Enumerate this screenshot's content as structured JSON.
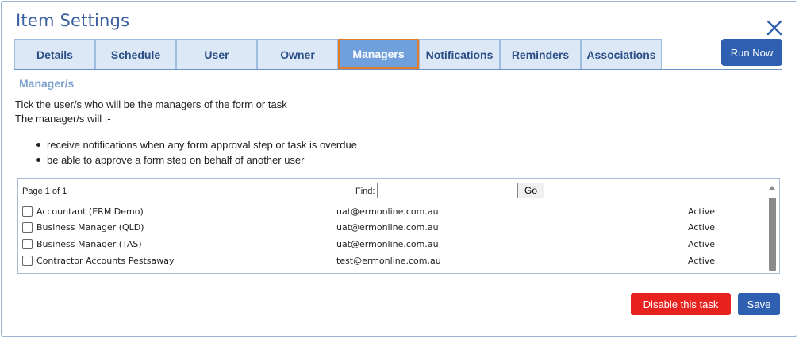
{
  "dialog": {
    "title": "Item Settings",
    "close_icon": "close-icon",
    "accent_color": "#2f5fb0",
    "danger_color": "#e8231f"
  },
  "tabs": [
    {
      "label": "Details",
      "active": false
    },
    {
      "label": "Schedule",
      "active": false
    },
    {
      "label": "User",
      "active": false
    },
    {
      "label": "Owner",
      "active": false
    },
    {
      "label": "Managers",
      "active": true
    },
    {
      "label": "Notifications",
      "active": false
    },
    {
      "label": "Reminders",
      "active": false
    },
    {
      "label": "Associations",
      "active": false
    }
  ],
  "toolbar": {
    "run_now_label": "Run Now"
  },
  "section": {
    "title": "Manager/s",
    "desc1": "Tick the user/s who will be the managers of the form or task",
    "desc2": "The manager/s will :-",
    "bullets": [
      "receive notifications when any form approval step or task is overdue",
      "be able to approve a form step on behalf of another user"
    ]
  },
  "grid": {
    "pager": "Page 1 of 1",
    "find_label": "Find:",
    "find_value": "",
    "go_label": "Go",
    "rows": [
      {
        "name": "Accountant (ERM Demo)",
        "email": "uat@ermonline.com.au",
        "status": "Active",
        "checked": false
      },
      {
        "name": "Business Manager (QLD)",
        "email": "uat@ermonline.com.au",
        "status": "Active",
        "checked": false
      },
      {
        "name": "Business Manager (TAS)",
        "email": "uat@ermonline.com.au",
        "status": "Active",
        "checked": false
      },
      {
        "name": "Contractor Accounts Pestsaway",
        "email": "test@ermonline.com.au",
        "status": "Active",
        "checked": false
      }
    ]
  },
  "footer": {
    "disable_label": "Disable this task",
    "save_label": "Save"
  }
}
